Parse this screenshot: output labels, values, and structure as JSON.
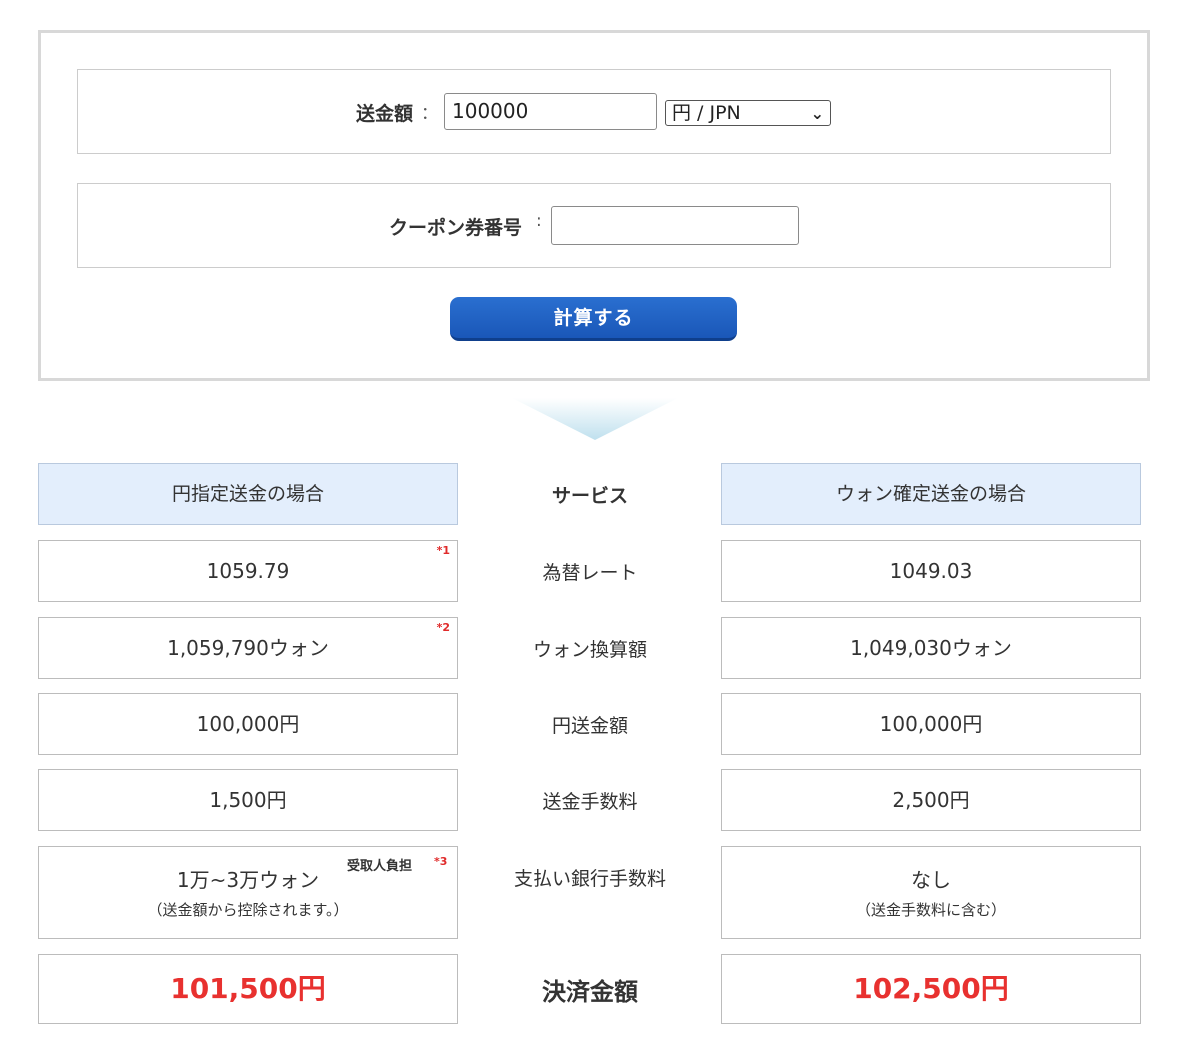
{
  "form": {
    "amount_label": "送金額",
    "colon": "：",
    "amount_value": "100000",
    "currency_selected": "円 / JPN",
    "coupon_label": "クーポン券番号",
    "coupon_colon": ":",
    "coupon_value": "",
    "calculate_label": "計算する"
  },
  "comparison": {
    "left_header": "円指定送金の場合",
    "center_header": "サービス",
    "right_header": "ウォン確定送金の場合",
    "rows": [
      {
        "label": "為替レート",
        "left": "1059.79",
        "left_note": "*1",
        "right": "1049.03"
      },
      {
        "label": "ウォン換算額",
        "left": "1,059,790ウォン",
        "left_note": "*2",
        "right": "1,049,030ウォン"
      },
      {
        "label": "円送金額",
        "left": "100,000円",
        "right": "100,000円"
      },
      {
        "label": "送金手数料",
        "left": "1,500円",
        "right": "2,500円"
      },
      {
        "label": "支払い銀行手数料",
        "left": "1万~3万ウォン",
        "left_sub": "（送金額から控除されます。）",
        "left_burden": "受取人負担",
        "left_note": "*3",
        "right": "なし",
        "right_sub": "（送金手数料に含む）"
      }
    ],
    "total_label": "決済金額",
    "total_left": "101,500円",
    "total_right": "102,500円"
  },
  "colors": {
    "accent_blue": "#1a57b8",
    "header_bg": "#e3eefc",
    "total_red": "#e8312f"
  }
}
